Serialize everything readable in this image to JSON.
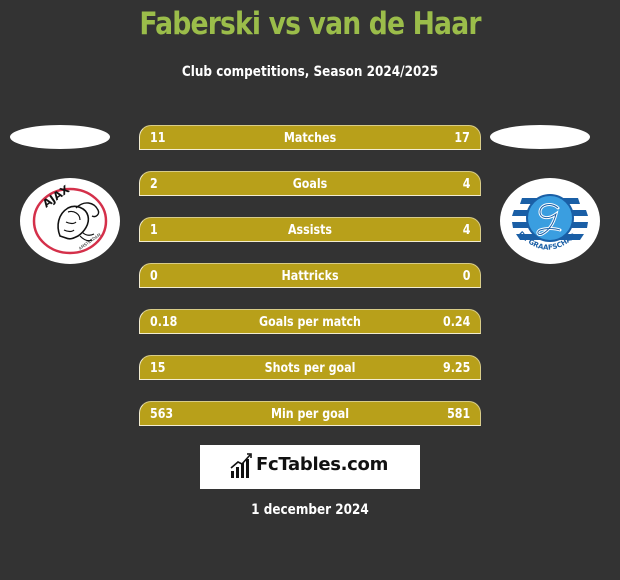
{
  "header": {
    "title": "Faberski vs van de Haar",
    "subtitle": "Club competitions, Season 2024/2025"
  },
  "teams": {
    "left": {
      "name": "Ajax Amsterdam",
      "logo_icon": "ajax-crest-icon",
      "logo_text": "AJAX",
      "logo_subtext": "AMSTERDAM"
    },
    "right": {
      "name": "De Graafschap",
      "logo_icon": "de-graafschap-crest-icon",
      "logo_text": "DE GRAAFSCHAP"
    }
  },
  "colors": {
    "background": "#333333",
    "title": "#9bbd4a",
    "bar": "#b8a01a",
    "text": "#ffffff"
  },
  "stats": [
    {
      "label": "Matches",
      "left": "11",
      "right": "17"
    },
    {
      "label": "Goals",
      "left": "2",
      "right": "4"
    },
    {
      "label": "Assists",
      "left": "1",
      "right": "4"
    },
    {
      "label": "Hattricks",
      "left": "0",
      "right": "0"
    },
    {
      "label": "Goals per match",
      "left": "0.18",
      "right": "0.24"
    },
    {
      "label": "Shots per goal",
      "left": "15",
      "right": "9.25"
    },
    {
      "label": "Min per goal",
      "left": "563",
      "right": "581"
    }
  ],
  "footer": {
    "brand": "FcTables.com",
    "brand_icon": "bar-chart-trend-icon",
    "date": "1 december 2024"
  }
}
